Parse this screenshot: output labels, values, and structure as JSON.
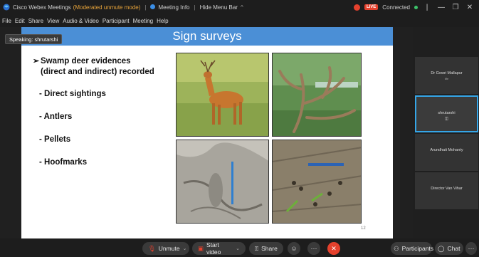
{
  "titlebar": {
    "app_name": "Cisco Webex Meetings",
    "mode": "(Moderated unmute mode)",
    "meeting_info": "Meeting Info",
    "hide_menu": "Hide Menu Bar",
    "status": "Connected",
    "live_label": "LIVE"
  },
  "menu": [
    "File",
    "Edit",
    "Share",
    "View",
    "Audio & Video",
    "Participant",
    "Meeting",
    "Help"
  ],
  "speaking": "Speaking: shrutarshi",
  "slide": {
    "title": "Sign surveys",
    "main_bullet_line1": "Swamp deer evidences",
    "main_bullet_line2": "(direct and indirect) recorded",
    "items": [
      "- Direct sightings",
      "- Antlers",
      "- Pellets",
      "- Hoofmarks"
    ],
    "page_number": "12"
  },
  "participants": [
    {
      "name": "Dr Gowri Mallapur",
      "role": "Me"
    },
    {
      "name": "shrutarshi",
      "role": ""
    },
    {
      "name": "Arundhati Mohanty",
      "role": ""
    },
    {
      "name": "Director Van Vihar",
      "role": ""
    }
  ],
  "controls": {
    "unmute": "Unmute",
    "start_video": "Start video",
    "share": "Share",
    "participants": "Participants",
    "chat": "Chat"
  },
  "colors": {
    "slide_header": "#4b8fd6",
    "accent": "#35a6e8",
    "danger": "#e5412d",
    "connected": "#3cc36a"
  }
}
